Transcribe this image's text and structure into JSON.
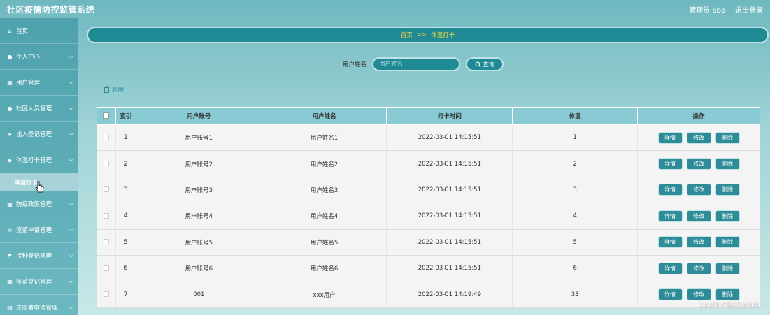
{
  "header": {
    "title": "社区疫情防控监管系统",
    "admin": "管理员 abo",
    "logout": "退出登录"
  },
  "sidebar": {
    "items": [
      {
        "label": "首页",
        "icon": "home-icon",
        "glyph": "⌂"
      },
      {
        "label": "个人中心",
        "icon": "user-icon",
        "glyph": "●"
      },
      {
        "label": "用户管理",
        "icon": "users-icon",
        "glyph": "▦"
      },
      {
        "label": "社区人员管理",
        "icon": "person-icon",
        "glyph": "●"
      },
      {
        "label": "出入登记管理",
        "icon": "send-icon",
        "glyph": "➤"
      },
      {
        "label": "体温打卡管理",
        "icon": "thumb-icon",
        "glyph": "◆"
      }
    ],
    "submenu_label": "体温打卡",
    "items_after": [
      {
        "label": "防疫政策管理",
        "icon": "grid-icon",
        "glyph": "▦"
      },
      {
        "label": "疫苗申请管理",
        "icon": "list-icon",
        "glyph": "≡"
      },
      {
        "label": "接种登记管理",
        "icon": "flag-icon",
        "glyph": "⚑"
      },
      {
        "label": "疫苗登记管理",
        "icon": "grid-icon",
        "glyph": "▦"
      },
      {
        "label": "志愿者申请管理",
        "icon": "table-icon",
        "glyph": "▤"
      }
    ]
  },
  "breadcrumb": {
    "home": "首页",
    "sep": ">>",
    "current": "体温打卡"
  },
  "search": {
    "label": "用户姓名",
    "placeholder": "用户姓名",
    "button": "查询"
  },
  "delete_label": "删除",
  "table": {
    "headers": [
      "索引",
      "用户账号",
      "用户姓名",
      "打卡时间",
      "体温",
      "操作"
    ],
    "rows": [
      {
        "idx": "1",
        "account": "用户账号1",
        "name": "用户姓名1",
        "time": "2022-03-01 14:15:51",
        "temp": "1"
      },
      {
        "idx": "2",
        "account": "用户账号2",
        "name": "用户姓名2",
        "time": "2022-03-01 14:15:51",
        "temp": "2"
      },
      {
        "idx": "3",
        "account": "用户账号3",
        "name": "用户姓名3",
        "time": "2022-03-01 14:15:51",
        "temp": "3"
      },
      {
        "idx": "4",
        "account": "用户账号4",
        "name": "用户姓名4",
        "time": "2022-03-01 14:15:51",
        "temp": "4"
      },
      {
        "idx": "5",
        "account": "用户账号5",
        "name": "用户姓名5",
        "time": "2022-03-01 14:15:51",
        "temp": "5"
      },
      {
        "idx": "6",
        "account": "用户账号6",
        "name": "用户姓名6",
        "time": "2022-03-01 14:15:51",
        "temp": "6"
      },
      {
        "idx": "7",
        "account": "001",
        "name": "xxx用户",
        "time": "2022-03-01 14:19:49",
        "temp": "33"
      }
    ],
    "actions": [
      "详情",
      "修改",
      "删除"
    ]
  },
  "watermark": "CSDN @bishe409",
  "colors": {
    "accent": "#1f8a94",
    "breadcrumb_text": "#f6d548",
    "header_row": "#88cbd4"
  }
}
